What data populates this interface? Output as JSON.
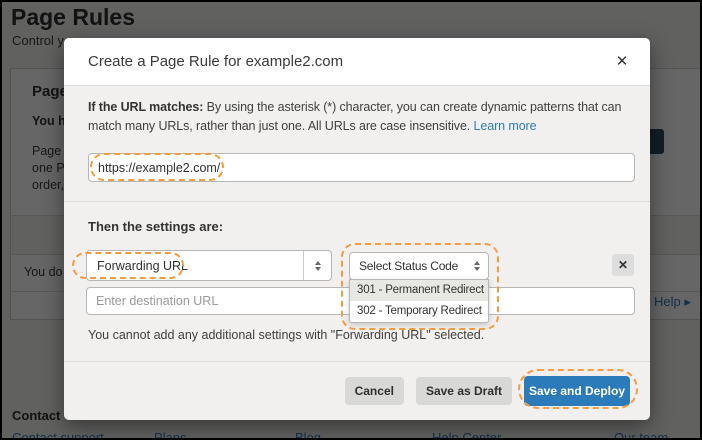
{
  "colors": {
    "accent_blue": "#2b7ab9",
    "link_blue": "#2f7cba",
    "annotation_orange": "#f79b3f"
  },
  "background": {
    "page_title": "Page Rules",
    "page_subtitle": "Control y",
    "card": {
      "title": "Page",
      "bold_line": "You ha",
      "lines": [
        "Page R",
        "one Pa",
        "order,"
      ],
      "empty_row_text": "You do n"
    },
    "help": {
      "label": "Help",
      "arrow_icon": "▸"
    },
    "footer": {
      "heading": "Contact",
      "links": [
        "Contact support",
        "Plans",
        "Blog",
        "Help Center",
        "Our team"
      ]
    }
  },
  "modal": {
    "title": "Create a Page Rule for example2.com",
    "close_icon": "✕",
    "url_section": {
      "label": "If the URL matches:",
      "line1": "By using the asterisk (*) character, you can create dynamic patterns that can",
      "line2": "match many URLs, rather than just one. All URLs are case insensitive.",
      "learn_more": "Learn more",
      "url_value": "https://example2.com/"
    },
    "settings_section": {
      "heading": "Then the settings are:",
      "setting_value": "Forwarding URL",
      "status_placeholder": "Select Status Code",
      "status_options": [
        "301 - Permanent Redirect",
        "302 - Temporary Redirect"
      ],
      "destination_placeholder": "Enter destination URL",
      "remove_icon": "✕",
      "note": "You cannot add any additional settings with \"Forwarding URL\" selected."
    },
    "footer": {
      "cancel": "Cancel",
      "save_draft": "Save as Draft",
      "save_deploy": "Save and Deploy"
    }
  }
}
